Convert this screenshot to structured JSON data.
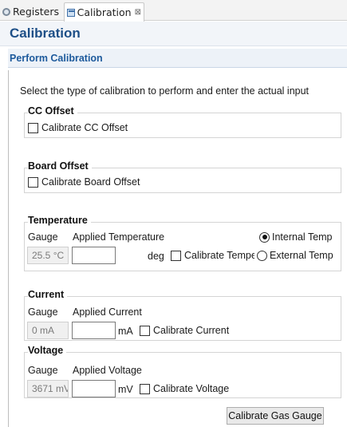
{
  "tabs": [
    {
      "label": "Registers",
      "icon": "gear-icon"
    },
    {
      "label": "Calibration",
      "icon": "view-icon",
      "close_glyph": "⊠"
    }
  ],
  "header": {
    "title": "Calibration"
  },
  "section": {
    "title": "Perform Calibration"
  },
  "instructions": "Select the type of calibration to perform and enter the actual input",
  "cc_offset": {
    "title": "CC Offset",
    "checkbox_label": "Calibrate CC Offset",
    "checked": false
  },
  "board_offset": {
    "title": "Board Offset",
    "checkbox_label": "Calibrate Board Offset",
    "checked": false
  },
  "temperature": {
    "title": "Temperature",
    "gauge_label": "Gauge",
    "applied_label": "Applied Temperature",
    "gauge_value": "25.5 °C",
    "input_value": "",
    "unit": "deg",
    "checkbox_label": "Calibrate Temperature",
    "radio_internal": "Internal Temp",
    "radio_external": "External Temp",
    "selected_radio": "Internal Temp"
  },
  "current": {
    "title": "Current",
    "gauge_label": "Gauge",
    "applied_label": "Applied Current",
    "gauge_value": "0 mA",
    "input_value": "",
    "unit": "mA",
    "checkbox_label": "Calibrate Current"
  },
  "voltage": {
    "title": "Voltage",
    "gauge_label": "Gauge",
    "applied_label": "Applied Voltage",
    "gauge_value": "3671 mV",
    "input_value": "",
    "unit": "mV",
    "checkbox_label": "Calibrate Voltage"
  },
  "actions": {
    "calibrate_button": "Calibrate Gas Gauge"
  },
  "colors": {
    "header_title": "#1d4f87",
    "section_title": "#1d5a9c"
  }
}
